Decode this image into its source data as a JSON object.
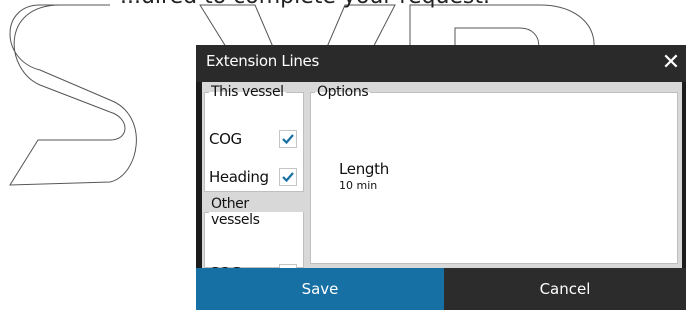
{
  "top_text": "...uired to complete your request.",
  "dialog": {
    "title": "Extension Lines",
    "close_glyph": "✕"
  },
  "this_vessel": {
    "legend": "This vessel",
    "items": [
      {
        "label": "COG",
        "checked": true
      },
      {
        "label": "Heading",
        "checked": true
      }
    ]
  },
  "other_vessels": {
    "legend": "Other vessels",
    "items": [
      {
        "label": "COG",
        "checked": false
      }
    ]
  },
  "options": {
    "legend": "Options",
    "length_label": "Length",
    "length_value": "10 min"
  },
  "buttons": {
    "save": "Save",
    "cancel": "Cancel"
  },
  "colors": {
    "accent": "#1670a3",
    "check": "#1670a3",
    "dialog_bg": "#1c1c1c",
    "content_bg": "#d8d8d8"
  },
  "icons": {
    "close": "close-icon",
    "check": "checkmark-icon"
  }
}
